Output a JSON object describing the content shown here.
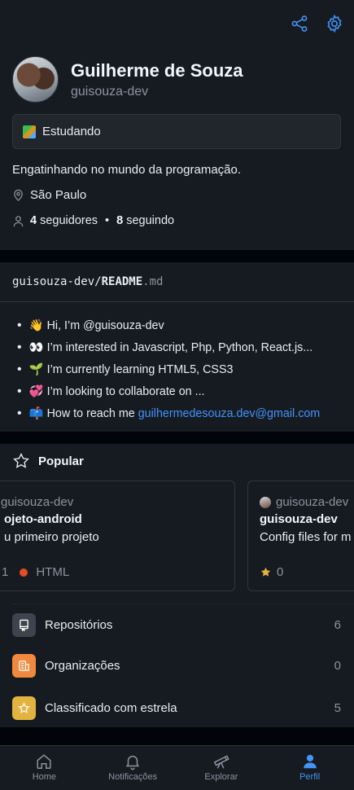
{
  "profile": {
    "name": "Guilherme de Souza",
    "username": "guisouza-dev",
    "status": "Estudando",
    "bio": "Engatinhando no mundo da programação.",
    "location": "São Paulo",
    "followers_count": "4",
    "followers_label": "seguidores",
    "following_count": "8",
    "following_label": "seguindo"
  },
  "readme": {
    "owner": "guisouza-dev",
    "file": "README",
    "ext": ".md",
    "items": [
      {
        "emoji": "👋",
        "text": "Hi, I’m @guisouza-dev"
      },
      {
        "emoji": "👀",
        "text": "I’m interested in Javascript, Php, Python, React.js..."
      },
      {
        "emoji": "🌱",
        "text": "I’m currently learning HTML5, CSS3"
      },
      {
        "emoji": "💞️",
        "text": "I’m looking to collaborate on ..."
      },
      {
        "emoji": "📫",
        "text": "How to reach me",
        "link": "guilhermedesouza.dev@gmail.com"
      }
    ]
  },
  "popular": {
    "title": "Popular",
    "cards": [
      {
        "owner": "guisouza-dev",
        "repo": "projeto-android",
        "repo_visible": "ojeto-android",
        "desc_visible": "u primeiro projeto",
        "stars": "1",
        "language": "HTML",
        "owner_visible": "guisouza-dev"
      },
      {
        "owner": "guisouza-dev",
        "repo": "guisouza-dev",
        "desc_visible": "Config files for m",
        "stars": "0"
      }
    ]
  },
  "lists": [
    {
      "label": "Repositórios",
      "count": "6",
      "icon": "repo-icon",
      "color": "#3d444d"
    },
    {
      "label": "Organizações",
      "count": "0",
      "icon": "organization-icon",
      "color": "#f0883e"
    },
    {
      "label": "Classificado com estrela",
      "count": "5",
      "icon": "star-icon",
      "color": "#e3b341"
    }
  ],
  "tabs": [
    {
      "label": "Home",
      "icon": "home-icon"
    },
    {
      "label": "Notificações",
      "icon": "bell-icon"
    },
    {
      "label": "Explorar",
      "icon": "telescope-icon"
    },
    {
      "label": "Perfil",
      "icon": "person-icon",
      "active": true
    }
  ],
  "colors": {
    "accent": "#4493f8",
    "background": "#010409",
    "surface": "#161b22",
    "border": "#30363d",
    "html_language": "#e34c26"
  }
}
